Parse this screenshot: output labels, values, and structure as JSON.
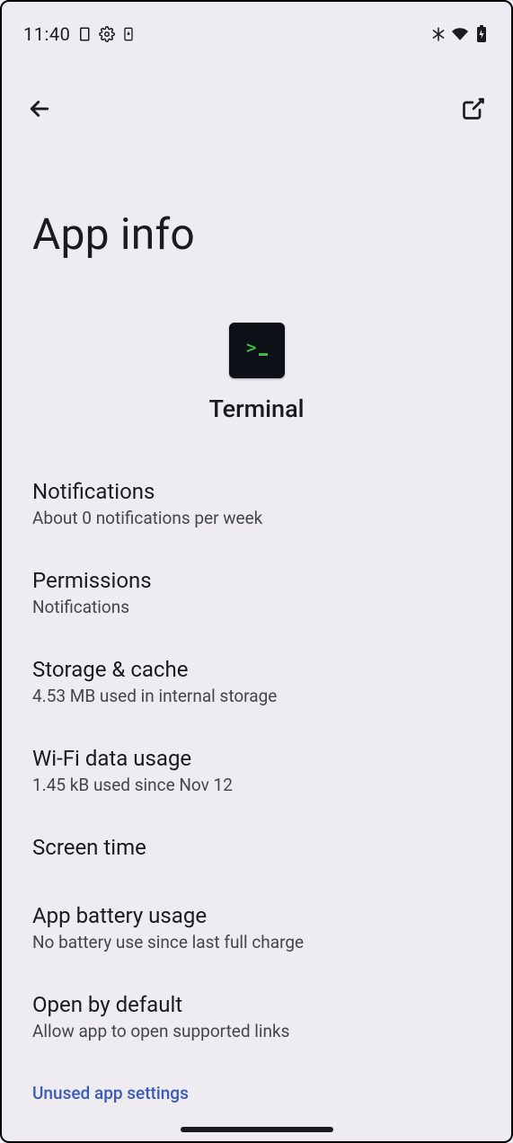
{
  "statusbar": {
    "time": "11:40"
  },
  "header": {
    "title": "App info"
  },
  "app": {
    "name": "Terminal"
  },
  "settings": {
    "notifications": {
      "title": "Notifications",
      "sub": "About 0 notifications per week"
    },
    "permissions": {
      "title": "Permissions",
      "sub": "Notifications"
    },
    "storage": {
      "title": "Storage & cache",
      "sub": "4.53 MB used in internal storage"
    },
    "wifi": {
      "title": "Wi-Fi data usage",
      "sub": "1.45 kB used since Nov 12"
    },
    "screentime": {
      "title": "Screen time"
    },
    "battery": {
      "title": "App battery usage",
      "sub": "No battery use since last full charge"
    },
    "opendefault": {
      "title": "Open by default",
      "sub": "Allow app to open supported links"
    },
    "unused": {
      "title": "Unused app settings"
    }
  }
}
